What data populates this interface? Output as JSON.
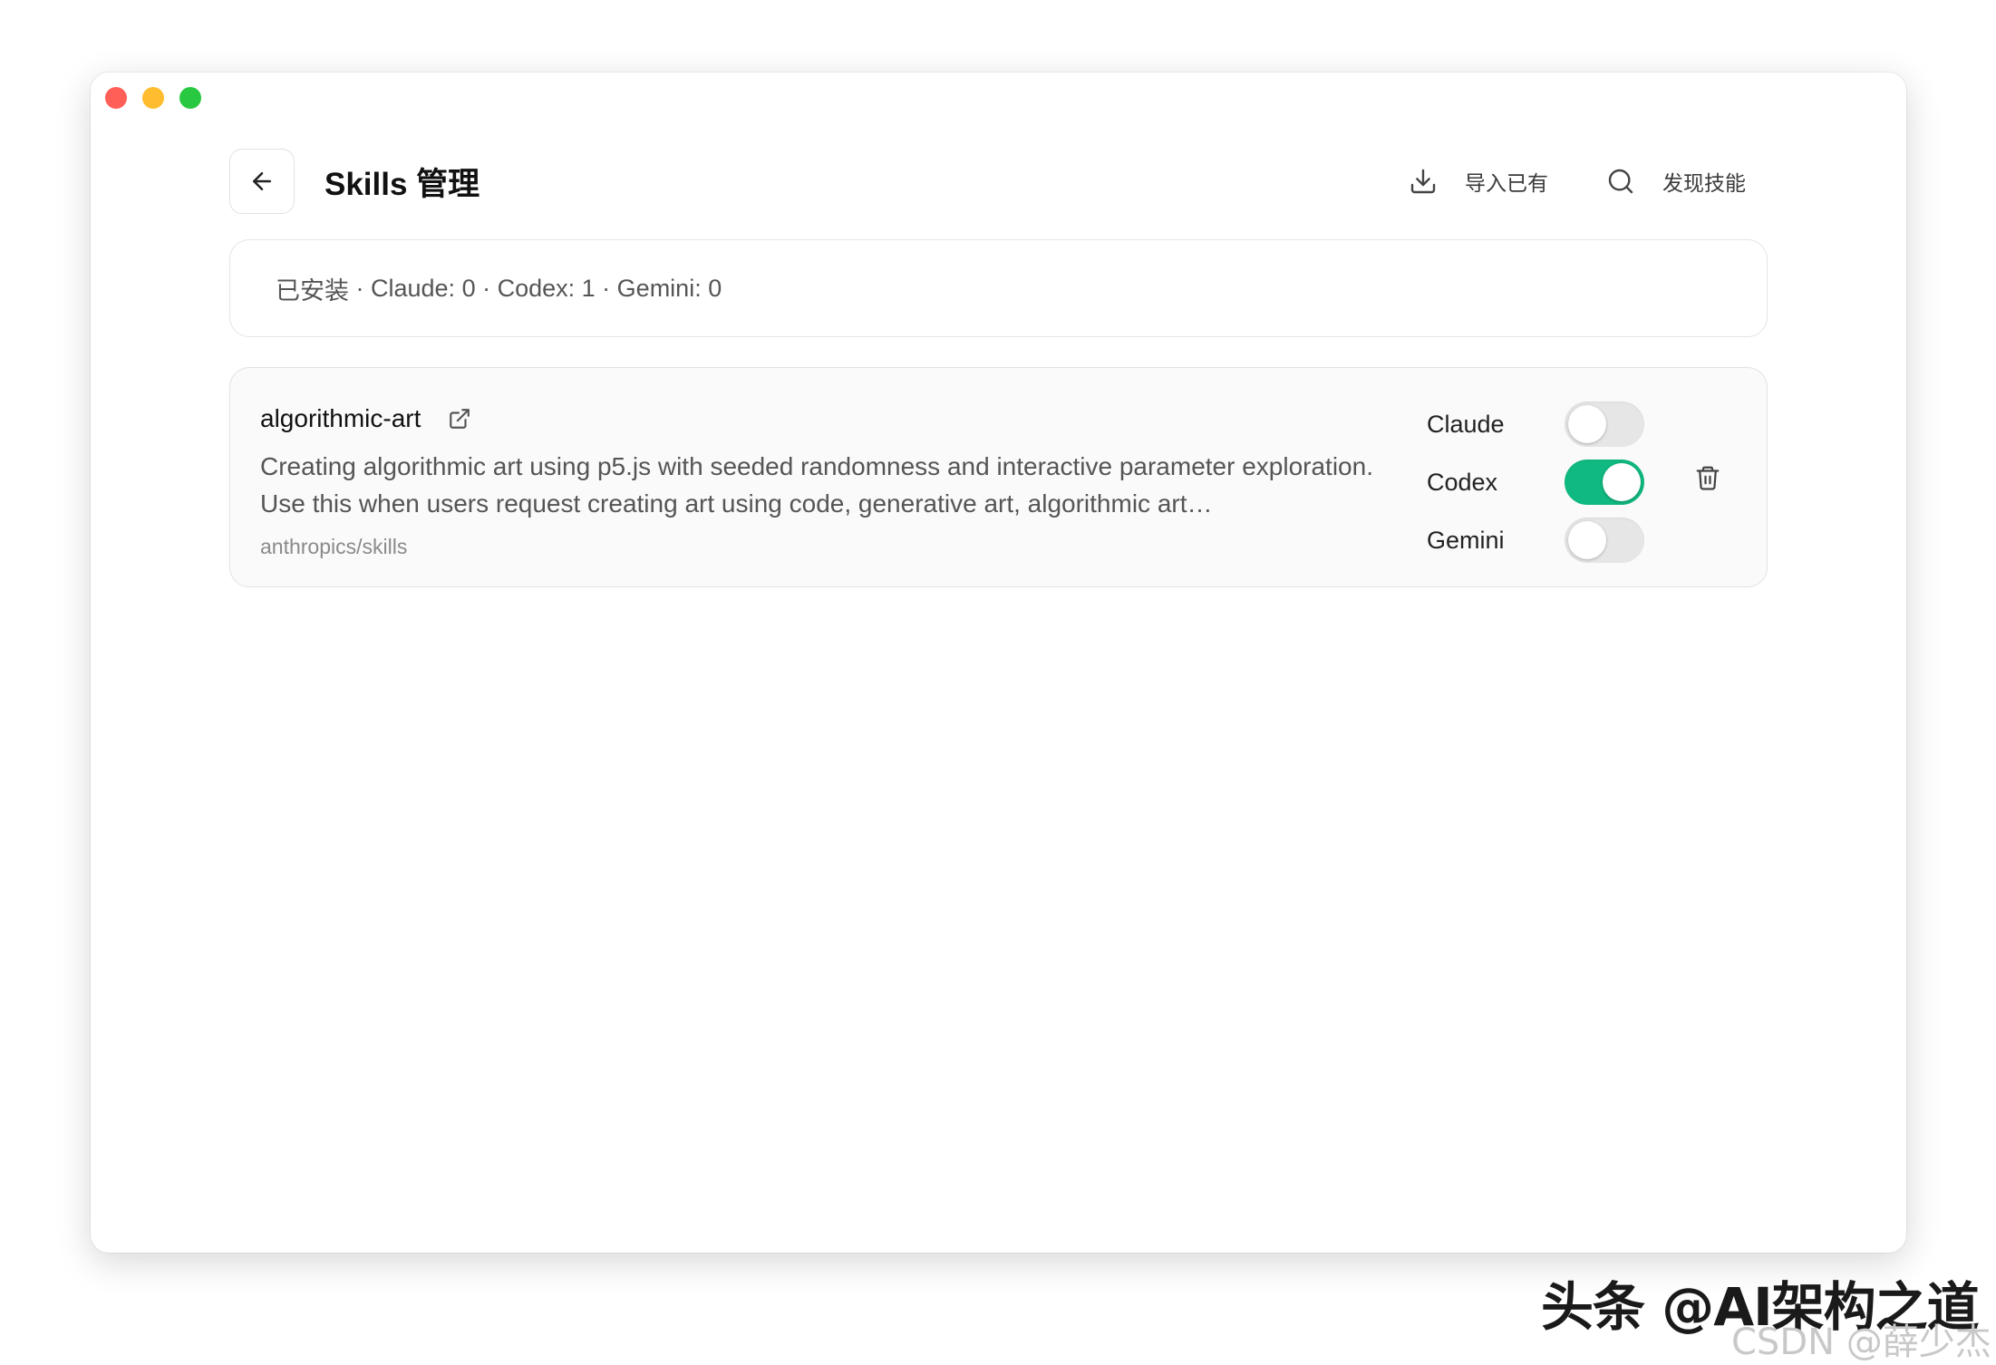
{
  "header": {
    "title": "Skills 管理",
    "import_label": "导入已有",
    "discover_label": "发现技能"
  },
  "summary": {
    "installed_label": "已安装",
    "separator": " · ",
    "claude": "Claude: 0",
    "codex": "Codex: 1",
    "gemini": "Gemini: 0"
  },
  "skills": [
    {
      "name": "algorithmic-art",
      "description": "Creating algorithmic art using p5.js with seeded randomness and interactive parameter exploration. Use this when users request creating art using code, generative art, algorithmic art…",
      "source": "anthropics/skills",
      "toggles": [
        {
          "label": "Claude",
          "enabled": false
        },
        {
          "label": "Codex",
          "enabled": true
        },
        {
          "label": "Gemini",
          "enabled": false
        }
      ]
    }
  ],
  "colors": {
    "toggle_on": "#10b981",
    "toggle_off": "#e6e6e6",
    "traffic_red": "#ff5f57",
    "traffic_yellow": "#febc2e",
    "traffic_green": "#28c840"
  },
  "icons": {
    "back": "arrow-left-icon",
    "import": "download-icon",
    "discover": "search-icon",
    "external": "external-link-icon",
    "delete": "trash-icon"
  },
  "watermark": {
    "primary": "头条 @AI架构之道",
    "secondary": "CSDN @薛少杰"
  }
}
